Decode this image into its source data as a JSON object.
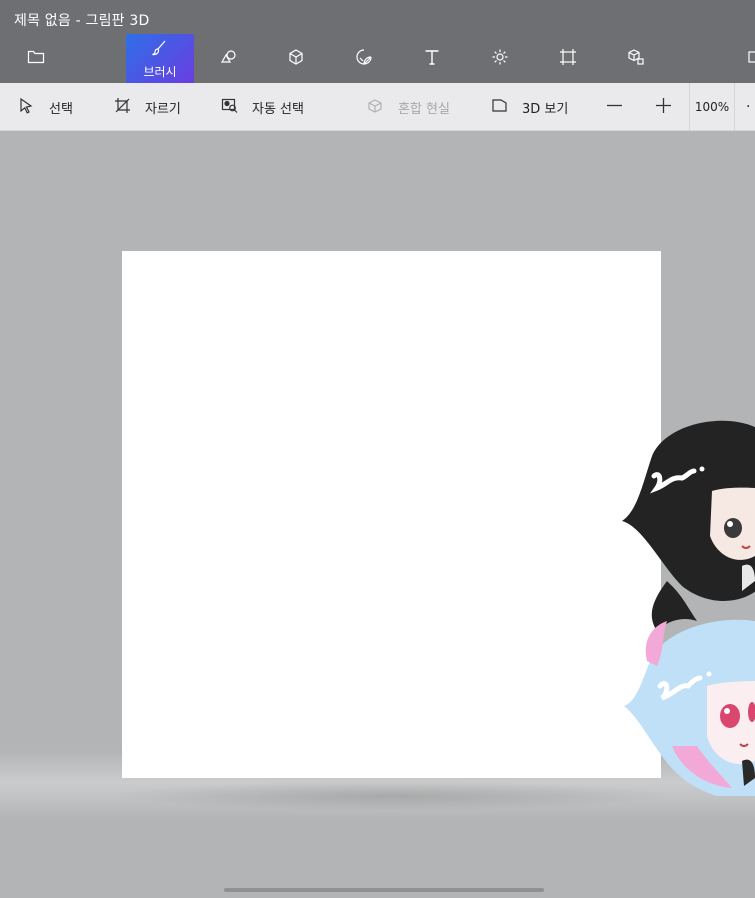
{
  "window": {
    "title": "제목 없음 - 그림판 3D"
  },
  "toolbar": {
    "tools": [
      {
        "name": "menu",
        "icon": "folder-icon"
      },
      {
        "name": "brushes",
        "label": "브러시",
        "icon": "brush-icon",
        "active": true
      },
      {
        "name": "2d-shapes",
        "icon": "2d-shapes-icon"
      },
      {
        "name": "3d-shapes",
        "icon": "3d-cube-icon"
      },
      {
        "name": "stickers",
        "icon": "sticker-icon"
      },
      {
        "name": "text",
        "icon": "text-icon"
      },
      {
        "name": "effects",
        "icon": "sun-icon"
      },
      {
        "name": "canvas",
        "icon": "canvas-icon"
      },
      {
        "name": "3d-library",
        "icon": "3d-library-icon"
      }
    ],
    "accent": "#2f6fe8"
  },
  "subbar": {
    "select": "선택",
    "crop": "자르기",
    "magic_select": "자동 선택",
    "mixed_reality": "혼합 현실",
    "view_3d": "3D 보기",
    "zoom": "100%"
  }
}
